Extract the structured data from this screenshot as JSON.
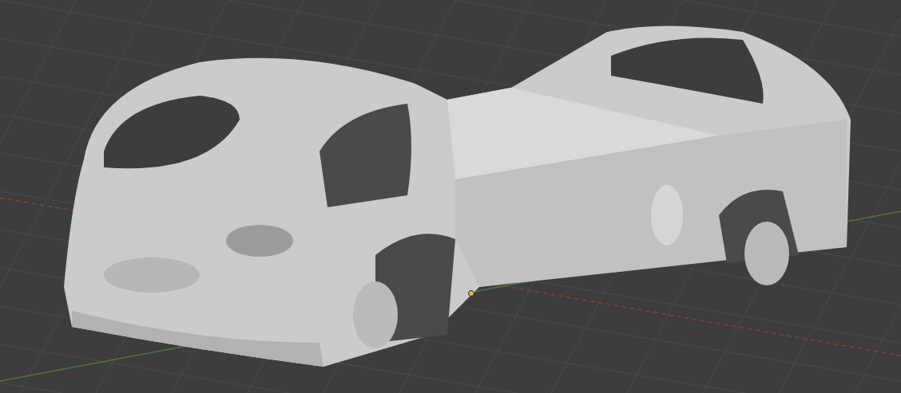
{
  "viewport": {
    "grid": true,
    "axes": true,
    "origin_marker": true
  }
}
